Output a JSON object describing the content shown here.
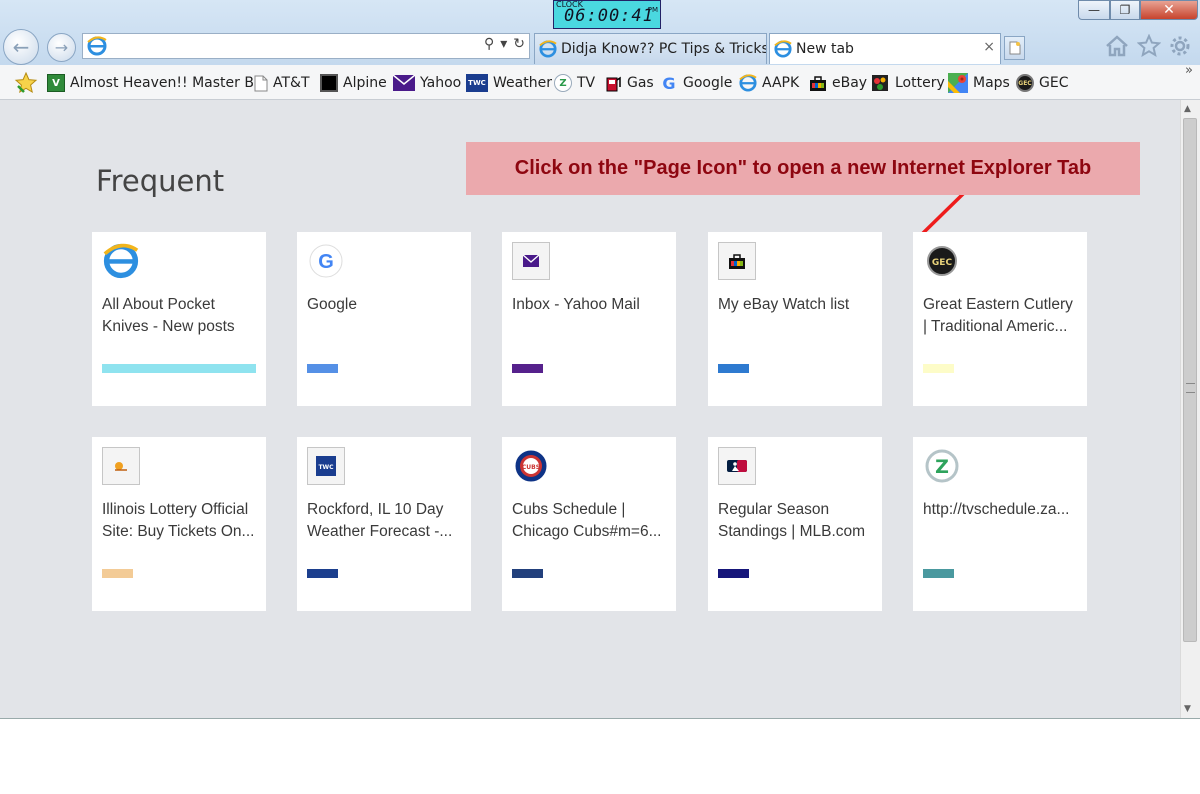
{
  "clock": {
    "label": "CLOCK",
    "time": "06:00:41",
    "ampm": "PM"
  },
  "window_controls": {
    "minimize": "—",
    "maximize": "❐",
    "close": "✕"
  },
  "address_bar": {
    "value": "",
    "search_glyph": "⚲",
    "dropdown_glyph": "▾",
    "refresh_glyph": "↻"
  },
  "tabs": [
    {
      "label": "Didja Know?? PC Tips & Tricks ...",
      "active": false
    },
    {
      "label": "New tab",
      "active": true,
      "close": "×"
    }
  ],
  "favorites": [
    {
      "label": "Almost Heaven!! Master B...",
      "icon": "v-icon"
    },
    {
      "label": "AT&T",
      "icon": "page-icon"
    },
    {
      "label": "Alpine",
      "icon": "black-square-icon"
    },
    {
      "label": "Yahoo",
      "icon": "mail-icon"
    },
    {
      "label": "Weather",
      "icon": "twc-icon",
      "icon_text": "TWC"
    },
    {
      "label": "TV",
      "icon": "z-icon",
      "icon_text": "Z"
    },
    {
      "label": "Gas",
      "icon": "gas-icon"
    },
    {
      "label": "Google",
      "icon": "google-icon",
      "icon_text": "G"
    },
    {
      "label": "AAPK",
      "icon": "ie-icon"
    },
    {
      "label": "eBay",
      "icon": "bag-icon"
    },
    {
      "label": "Lottery",
      "icon": "lottery-icon"
    },
    {
      "label": "Maps",
      "icon": "maps-icon"
    },
    {
      "label": "GEC",
      "icon": "gec-icon"
    }
  ],
  "overflow_chevron": "»",
  "content": {
    "heading": "Frequent",
    "callout": "Click on the \"Page Icon\" to open a new Internet Explorer Tab",
    "tiles": [
      {
        "title": "All About Pocket Knives - New posts",
        "icon": "ie-icon",
        "bar_color": "#8fe3ef",
        "bar_fraction": 1.0
      },
      {
        "title": "Google",
        "icon": "google-icon",
        "icon_text": "G",
        "bar_color": "#5590e6",
        "bar_fraction": 0.2
      },
      {
        "title": "Inbox - Yahoo Mail",
        "icon": "mail-icon",
        "bar_color": "#56218c",
        "bar_fraction": 0.2
      },
      {
        "title": "My eBay Watch list",
        "icon": "bag-icon",
        "bar_color": "#2e7ad0",
        "bar_fraction": 0.2
      },
      {
        "title": "Great Eastern Cutlery | Traditional Americ...",
        "icon": "gec-icon",
        "icon_text": "GEC",
        "bar_color": "#fdfcc8",
        "bar_fraction": 0.2
      },
      {
        "title": "Illinois Lottery Official Site: Buy Tickets On...",
        "icon": "lottery-icon",
        "bar_color": "#f3cb96",
        "bar_fraction": 0.2
      },
      {
        "title": "Rockford, IL 10 Day Weather Forecast -...",
        "icon": "twc-icon",
        "icon_text": "TWC",
        "bar_color": "#1c3f8e",
        "bar_fraction": 0.2
      },
      {
        "title": "Cubs Schedule | Chicago Cubs#m=6...",
        "icon": "cubs-icon",
        "icon_text": "CUBS",
        "bar_color": "#22407c",
        "bar_fraction": 0.2
      },
      {
        "title": "Regular Season Standings | MLB.com",
        "icon": "mlb-icon",
        "bar_color": "#16167a",
        "bar_fraction": 0.2
      },
      {
        "title": "http://tvschedule.za...",
        "icon": "z-icon",
        "icon_text": "Z",
        "bar_color": "#4a999f",
        "bar_fraction": 0.2
      }
    ]
  },
  "colors": {
    "accent_callout_bg": "#eba9ad",
    "callout_text": "#8e0610",
    "content_bg": "#e2e4e8",
    "arrow": "#ee1c1c"
  }
}
